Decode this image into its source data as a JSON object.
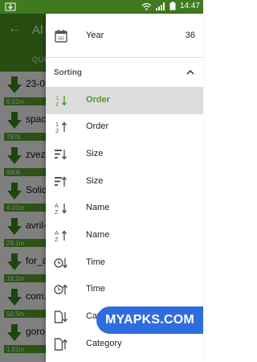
{
  "status_bar": {
    "time": "14:47"
  },
  "app": {
    "title": "Al",
    "tab": "QUE",
    "downloads": [
      {
        "name": "23-0",
        "size": "9.02m"
      },
      {
        "name": "spac",
        "size": "787k"
      },
      {
        "name": "zvez",
        "size": "880k"
      },
      {
        "name": "Solid",
        "size": "4.01m"
      },
      {
        "name": "avril-",
        "size": "29.1m"
      },
      {
        "name": "for_a",
        "size": "16.2m"
      },
      {
        "name": "com.",
        "size": "50.5m"
      },
      {
        "name": "goro",
        "size": "1.81m"
      }
    ]
  },
  "drawer": {
    "year": {
      "label": "Year",
      "value": "36",
      "icon": "calendar-icon"
    },
    "sorting_title": "Sorting",
    "items": [
      {
        "label": "Order",
        "icon": "sort-numeric-asc-icon",
        "selected": true
      },
      {
        "label": "Order",
        "icon": "sort-numeric-desc-icon",
        "selected": false
      },
      {
        "label": "Size",
        "icon": "sort-size-asc-icon",
        "selected": false
      },
      {
        "label": "Size",
        "icon": "sort-size-desc-icon",
        "selected": false
      },
      {
        "label": "Name",
        "icon": "sort-alpha-asc-icon",
        "selected": false
      },
      {
        "label": "Name",
        "icon": "sort-alpha-desc-icon",
        "selected": false
      },
      {
        "label": "Time",
        "icon": "sort-time-asc-icon",
        "selected": false
      },
      {
        "label": "Time",
        "icon": "sort-time-desc-icon",
        "selected": false
      },
      {
        "label": "Category",
        "icon": "sort-category-asc-icon",
        "selected": false
      },
      {
        "label": "Category",
        "icon": "sort-category-desc-icon",
        "selected": false
      }
    ]
  },
  "watermark": "MYAPKS.COM",
  "colors": {
    "accent": "#4f9a26",
    "status_bar": "#3f7a1f",
    "watermark": "#2f6ce0"
  }
}
